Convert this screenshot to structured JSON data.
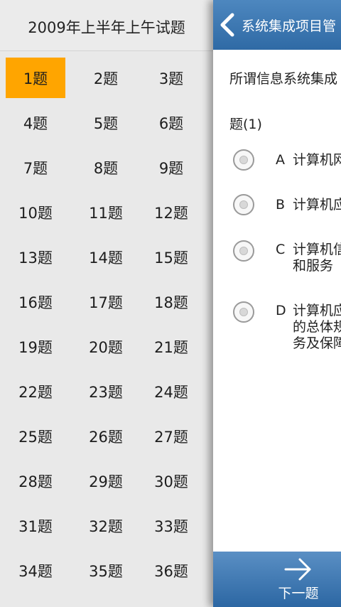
{
  "drawer": {
    "title": "2009年上半年上午试题",
    "items": [
      "1题",
      "2题",
      "3题",
      "4题",
      "5题",
      "6题",
      "7题",
      "8题",
      "9题",
      "10题",
      "11题",
      "12题",
      "13题",
      "14题",
      "15题",
      "16题",
      "17题",
      "18题",
      "19题",
      "20题",
      "21题",
      "22题",
      "23题",
      "24题",
      "25题",
      "26题",
      "27题",
      "28题",
      "29题",
      "30题",
      "31题",
      "32题",
      "33题",
      "34题",
      "35题",
      "36题"
    ],
    "active_index": 0,
    "active_color": "#ffa500"
  },
  "panel": {
    "header_title": "系统集成项目管",
    "question_text": "所谓信息系统集成",
    "question_number": "题(1)",
    "options": [
      {
        "letter": "A",
        "text": "计算机网"
      },
      {
        "letter": "B",
        "text": "计算机应"
      },
      {
        "letter": "C",
        "text": "计算机信\n和服务"
      },
      {
        "letter": "D",
        "text": "计算机应\n的总体规\n务及保障"
      }
    ],
    "next_label": "下一题",
    "header_color": "#3a77b3"
  }
}
